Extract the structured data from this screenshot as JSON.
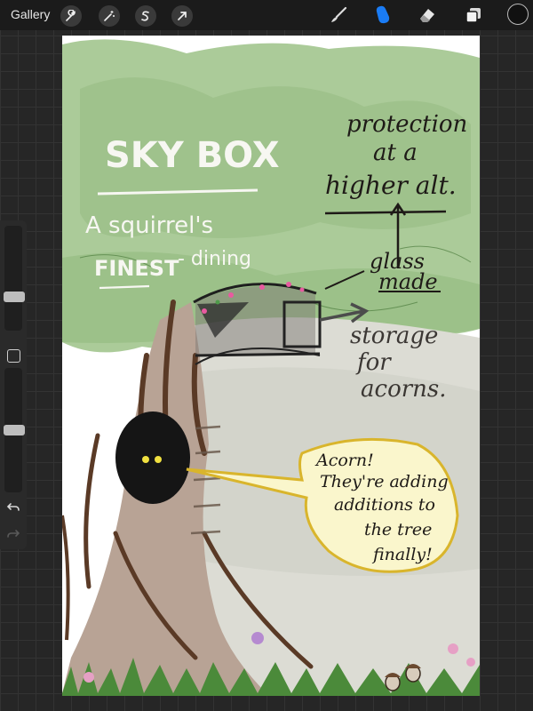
{
  "toolbar": {
    "gallery_label": "Gallery",
    "left_tools": [
      "wrench-icon",
      "magic-wand-icon",
      "selection-icon",
      "transform-arrow-icon"
    ],
    "right_tools": [
      "brush-icon",
      "smudge-icon",
      "eraser-icon",
      "layers-icon"
    ],
    "active_tool": "smudge-icon",
    "active_color_hex": "#111111",
    "accent_hex": "#1a7cf5"
  },
  "sidebar": {
    "brush_size_level": 0.3,
    "opacity_level": 0.5
  },
  "artwork": {
    "title": "SKY BOX",
    "subtitle_line1": "A squirrel's",
    "subtitle_emphasis": "FINEST",
    "subtitle_line2": "- dining",
    "note_protection_1": "protection",
    "note_protection_2": "at a",
    "note_protection_3": "higher alt.",
    "note_glass_1": "glass",
    "note_glass_2": "made",
    "note_storage_1": "storage",
    "note_storage_2": "for",
    "note_storage_3": "acorns.",
    "bubble_1": "Acorn!",
    "bubble_2": "They're adding",
    "bubble_3": "additions to",
    "bubble_4": "the tree",
    "bubble_5": "finally!"
  }
}
